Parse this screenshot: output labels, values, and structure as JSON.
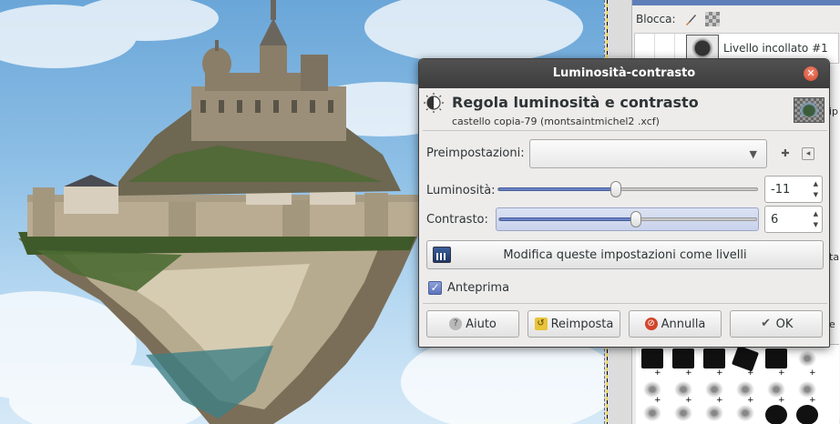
{
  "dialog": {
    "title": "Luminosità-contrasto",
    "header_title": "Regola luminosità e contrasto",
    "header_subtitle": "castello copia-79 (montsaintmichel2 .xcf)",
    "presets_label": "Preimpostazioni:",
    "presets_value": "",
    "brightness": {
      "label": "Luminosità:",
      "value": "-11",
      "fraction": 0.456
    },
    "contrast": {
      "label": "Contrasto:",
      "value": "6",
      "fraction": 0.53
    },
    "edit_as_levels_label": "Modifica queste impostazioni come livelli",
    "preview": {
      "label": "Anteprima",
      "checked": true
    },
    "buttons": {
      "help": "Aiuto",
      "reset": "Reimposta",
      "cancel": "Annulla",
      "ok": "OK"
    }
  },
  "dock": {
    "lock_label": "Blocca:",
    "layer_name": "Livello incollato #1",
    "side_letters": [
      "ip",
      "ta",
      "e"
    ]
  },
  "icons": {
    "close": "close-icon",
    "dialog_header": "brightness-contrast-icon",
    "levels": "levels-icon",
    "help": "help-icon",
    "reset": "reset-icon",
    "cancel": "cancel-icon",
    "ok": "check-icon"
  },
  "colors": {
    "titlebar": "#3c3c3c",
    "accent": "#5e7eb8",
    "close": "#d2452b"
  }
}
